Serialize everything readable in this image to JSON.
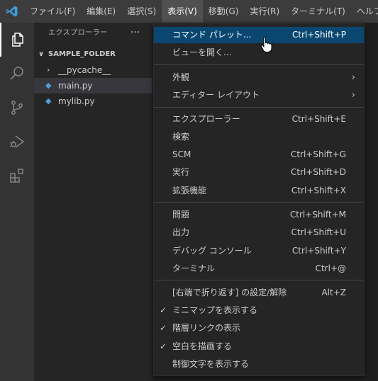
{
  "menubar": {
    "items": [
      "ファイル(F)",
      "編集(E)",
      "選択(S)",
      "表示(V)",
      "移動(G)",
      "実行(R)",
      "ターミナル(T)",
      "ヘルプ(H)"
    ],
    "active_index": 3
  },
  "activity_bar": {
    "icons": [
      "files-icon",
      "search-icon",
      "source-control-icon",
      "run-debug-icon",
      "extensions-icon"
    ],
    "active": "files-icon"
  },
  "sidebar": {
    "title": "エクスプローラー",
    "more": "···",
    "folder": "SAMPLE_FOLDER",
    "items": [
      {
        "label": "__pycache__",
        "type": "folder"
      },
      {
        "label": "main.py",
        "type": "python",
        "selected": true
      },
      {
        "label": "mylib.py",
        "type": "python"
      }
    ]
  },
  "view_menu": {
    "items": [
      {
        "label": "コマンド パレット...",
        "accel": "Ctrl+Shift+P",
        "highlight": true
      },
      {
        "label": "ビューを開く...",
        "accel": ""
      },
      {
        "label": "外観",
        "submenu": true
      },
      {
        "label": "エディター レイアウト",
        "submenu": true
      },
      {
        "label": "エクスプローラー",
        "accel": "Ctrl+Shift+E"
      },
      {
        "label": "検索",
        "accel": ""
      },
      {
        "label": "SCM",
        "accel": "Ctrl+Shift+G"
      },
      {
        "label": "実行",
        "accel": "Ctrl+Shift+D"
      },
      {
        "label": "拡張機能",
        "accel": "Ctrl+Shift+X"
      },
      {
        "label": "問題",
        "accel": "Ctrl+Shift+M"
      },
      {
        "label": "出力",
        "accel": "Ctrl+Shift+U"
      },
      {
        "label": "デバッグ コンソール",
        "accel": "Ctrl+Shift+Y"
      },
      {
        "label": "ターミナル",
        "accel": "Ctrl+@"
      },
      {
        "label": "[右端で折り返す] の設定/解除",
        "accel": "Alt+Z"
      },
      {
        "label": "ミニマップを表示する",
        "checked": true
      },
      {
        "label": "階層リンクの表示",
        "checked": true
      },
      {
        "label": "空白を描画する",
        "checked": true
      },
      {
        "label": "制御文字を表示する",
        "checked": false
      }
    ],
    "submenu_glyph": "›",
    "check_glyph": "✓"
  },
  "colors": {
    "accent_highlight": "#094771",
    "titlebar": "#3c3c3c",
    "activity_bar": "#333333",
    "sidebar": "#252526"
  }
}
